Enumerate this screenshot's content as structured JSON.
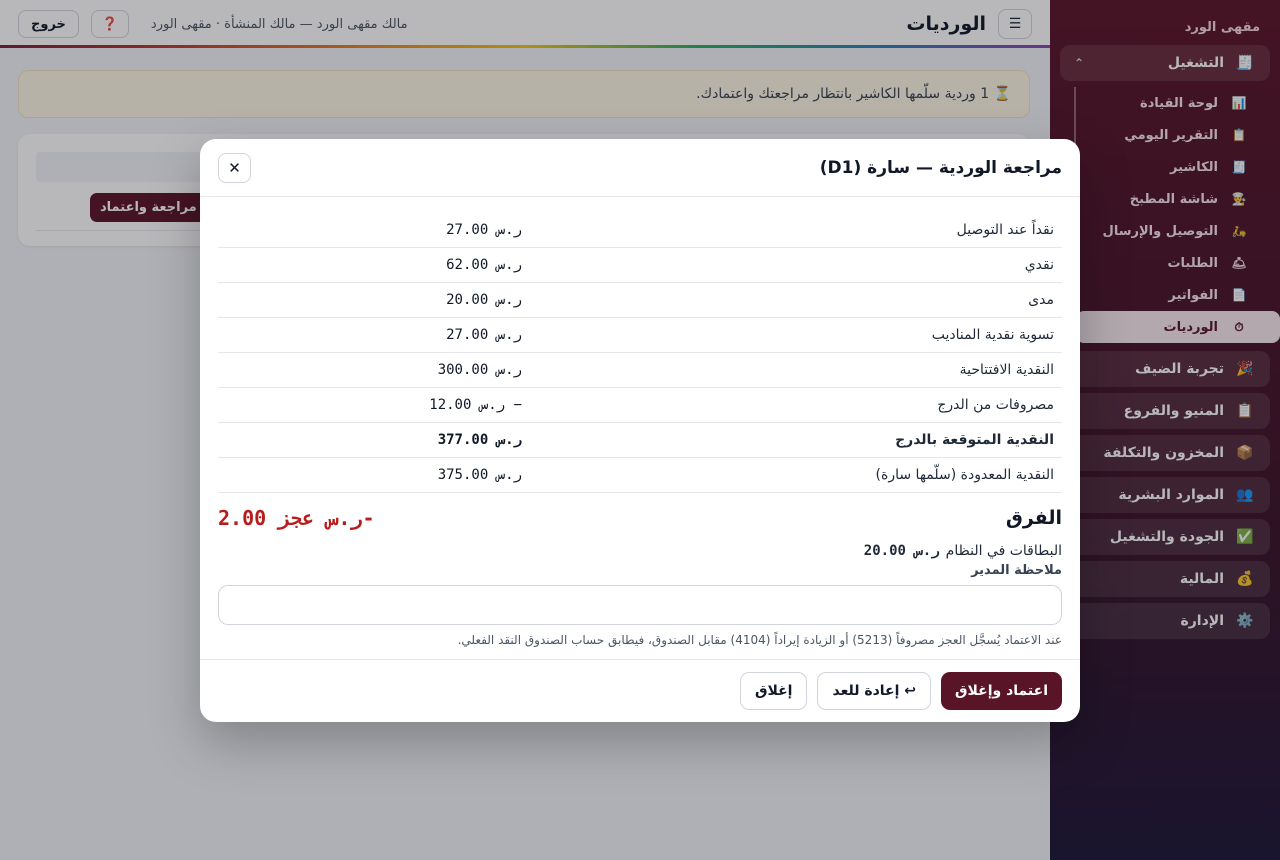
{
  "sidebar": {
    "brand": "مقهى الورد",
    "groups": [
      {
        "icon": "🧾",
        "label": "التشغيل",
        "expanded": true
      },
      {
        "icon": "🎉",
        "label": "تجربة الضيف"
      },
      {
        "icon": "📋",
        "label": "المنيو والفروع"
      },
      {
        "icon": "📦",
        "label": "المخزون والتكلفة"
      },
      {
        "icon": "👥",
        "label": "الموارد البشرية"
      },
      {
        "icon": "✅",
        "label": "الجودة والتشغيل"
      },
      {
        "icon": "💰",
        "label": "المالية"
      },
      {
        "icon": "⚙️",
        "label": "الإدارة"
      }
    ],
    "chevron": "⌃",
    "sub_items": [
      {
        "icon": "📊",
        "label": "لوحة القيادة"
      },
      {
        "icon": "📋",
        "label": "التقرير اليومي"
      },
      {
        "icon": "🧾",
        "label": "الكاشير"
      },
      {
        "icon": "👨‍🍳",
        "label": "شاشة المطبخ"
      },
      {
        "icon": "🛵",
        "label": "التوصيل والإرسال"
      },
      {
        "icon": "🛎",
        "label": "الطلبات"
      },
      {
        "icon": "📄",
        "label": "الفواتير"
      },
      {
        "icon": "⏱",
        "label": "الورديات",
        "active": true
      }
    ]
  },
  "header": {
    "menu_icon": "☰",
    "title": "الورديات",
    "owner_line": "مالك مقهى الورد — مالك المنشأة · مقهى الورد",
    "help_icon": "❓",
    "logout_label": "خروج"
  },
  "banner": {
    "text": "⏳ 1 وردية سلّمها الكاشير بانتظار مراجعتك واعتمادك."
  },
  "card": {
    "review_button": "مراجعة واعتماد"
  },
  "modal": {
    "title": "مراجعة الوردية — سارة (D1)",
    "close_icon": "✕",
    "rows": [
      {
        "label": "نقداً عند التوصيل",
        "value": "ر.س 27.00"
      },
      {
        "label": "نقدي",
        "value": "ر.س 62.00"
      },
      {
        "label": "مدى",
        "value": "ر.س 20.00"
      },
      {
        "label": "تسوية نقدية المناديب",
        "value": "ر.س 27.00"
      },
      {
        "label": "النقدية الافتتاحية",
        "value": "ر.س 300.00"
      },
      {
        "label": "مصروفات من الدرج",
        "value": "ر.س 12.00 −"
      },
      {
        "label": "النقدية المتوقعة بالدرج",
        "value": "ر.س 377.00",
        "bold": true
      },
      {
        "label": "النقدية المعدودة (سلّمها سارة)",
        "value": "ر.س 375.00"
      }
    ],
    "diff_label": "الفرق",
    "diff_value": "ر.س عجز 2.00-",
    "cards_label": "البطاقات في النظام",
    "cards_value": "ر.س 20.00",
    "note_label": "ملاحظة المدير",
    "note_value": "",
    "hint": "عند الاعتماد يُسجَّل العجز مصروفاً (5213) أو الزيادة إيراداً (4104) مقابل الصندوق، فيطابق حساب الصندوق النقد الفعلي.",
    "approve_button": "اعتماد وإغلاق",
    "recount_button": "↩ إعادة للعد",
    "close_button": "إغلاق"
  },
  "colors": {
    "brand": "#5a1428",
    "deficit": "#b91c1c"
  }
}
